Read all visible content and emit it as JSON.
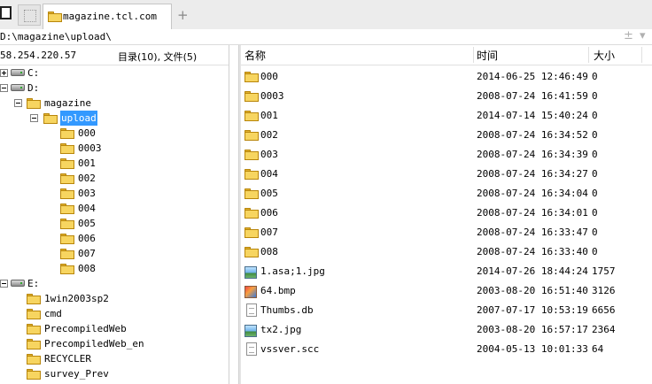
{
  "tabs": {
    "active_label": "magazine.tcl.com",
    "add_label": "+"
  },
  "path": {
    "text": "D:\\magazine\\upload\\",
    "plus": "±",
    "arrow": "▾"
  },
  "left": {
    "ip": "58.254.220.57",
    "stats": "目录(10), 文件(5)"
  },
  "columns": {
    "name": "名称",
    "time": "时间",
    "size": "大小"
  },
  "tree": {
    "c": "C:",
    "d": "D:",
    "magazine": "magazine",
    "upload": "upload",
    "upload_children": [
      "000",
      "0003",
      "001",
      "002",
      "003",
      "004",
      "005",
      "006",
      "007",
      "008"
    ],
    "e": "E:",
    "e_children": [
      "1win2003sp2",
      "cmd",
      "PrecompiledWeb",
      "PrecompiledWeb_en",
      "RECYCLER",
      "survey_Prev"
    ]
  },
  "files": [
    {
      "name": "000",
      "time": "2014-06-25 12:46:49",
      "size": "0",
      "icon": "folder-icon"
    },
    {
      "name": "0003",
      "time": "2008-07-24 16:41:59",
      "size": "0",
      "icon": "folder-icon"
    },
    {
      "name": "001",
      "time": "2014-07-14 15:40:24",
      "size": "0",
      "icon": "folder-icon"
    },
    {
      "name": "002",
      "time": "2008-07-24 16:34:52",
      "size": "0",
      "icon": "folder-icon"
    },
    {
      "name": "003",
      "time": "2008-07-24 16:34:39",
      "size": "0",
      "icon": "folder-icon"
    },
    {
      "name": "004",
      "time": "2008-07-24 16:34:27",
      "size": "0",
      "icon": "folder-icon"
    },
    {
      "name": "005",
      "time": "2008-07-24 16:34:04",
      "size": "0",
      "icon": "folder-icon"
    },
    {
      "name": "006",
      "time": "2008-07-24 16:34:01",
      "size": "0",
      "icon": "folder-icon"
    },
    {
      "name": "007",
      "time": "2008-07-24 16:33:47",
      "size": "0",
      "icon": "folder-icon"
    },
    {
      "name": "008",
      "time": "2008-07-24 16:33:40",
      "size": "0",
      "icon": "folder-icon"
    },
    {
      "name": "1.asa;1.jpg",
      "time": "2014-07-26 18:44:24",
      "size": "1757",
      "icon": "image-file-icon"
    },
    {
      "name": "64.bmp",
      "time": "2003-08-20 16:51:40",
      "size": "3126",
      "icon": "bitmap-file-icon"
    },
    {
      "name": "Thumbs.db",
      "time": "2007-07-17 10:53:19",
      "size": "6656",
      "icon": "document-file-icon"
    },
    {
      "name": "tx2.jpg",
      "time": "2003-08-20 16:57:17",
      "size": "2364",
      "icon": "image-file-icon"
    },
    {
      "name": "vssver.scc",
      "time": "2004-05-13 10:01:33",
      "size": "64",
      "icon": "generic-file-icon"
    }
  ],
  "colors": {
    "selection": "#3399ff",
    "folder": "#f7d560"
  }
}
